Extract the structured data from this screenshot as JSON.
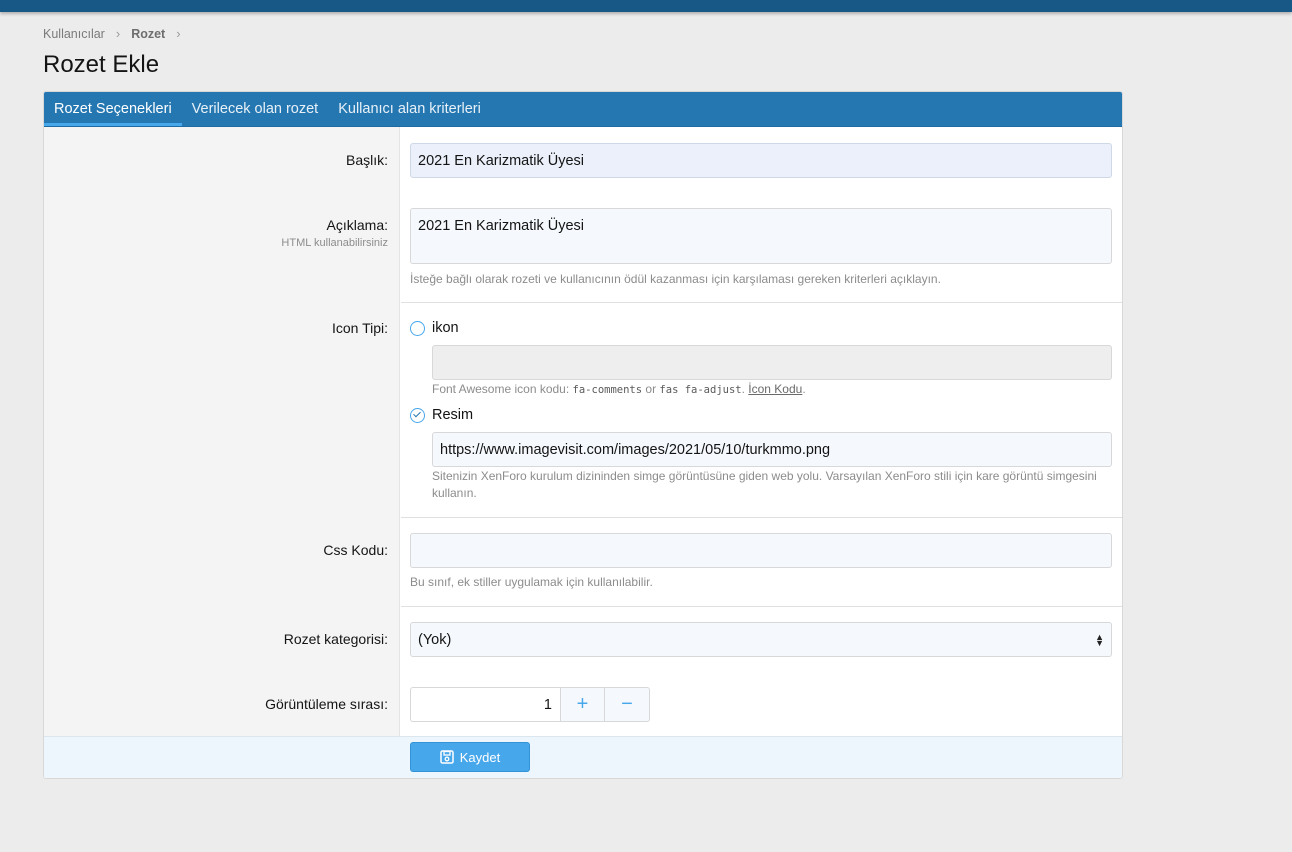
{
  "breadcrumb": {
    "item1": "Kullanıcılar",
    "item2": "Rozet"
  },
  "page_title": "Rozet Ekle",
  "tabs": [
    "Rozet Seçenekleri",
    "Verilecek olan rozet",
    "Kullanıcı alan kriterleri"
  ],
  "form": {
    "title_label": "Başlık:",
    "title_value": "2021 En Karizmatik Üyesi",
    "desc_label": "Açıklama:",
    "desc_hint": "HTML kullanabilirsiniz",
    "desc_value": "2021 En Karizmatik Üyesi",
    "desc_explain": "İsteğe bağlı olarak rozeti ve kullanıcının ödül kazanması için karşılaması gereken kriterleri açıklayın.",
    "icon_type_label": "Icon Tipi:",
    "icon_option": "ikon",
    "icon_explain_prefix": "Font Awesome icon kodu: ",
    "icon_explain_code1": "fa-comments",
    "icon_explain_or": " or ",
    "icon_explain_code2": "fas fa-adjust",
    "icon_explain_dot": ". ",
    "icon_explain_link": "İcon Kodu",
    "icon_explain_end": ".",
    "image_option": "Resim",
    "image_value": "https://www.imagevisit.com/images/2021/05/10/turkmmo.png",
    "image_explain": "Sitenizin XenForo kurulum dizininden simge görüntüsüne giden web yolu. Varsayılan XenForo stili için kare görüntü simgesini kullanın.",
    "css_label": "Css Kodu:",
    "css_value": "",
    "css_explain": "Bu sınıf, ek stiller uygulamak için kullanılabilir.",
    "category_label": "Rozet kategorisi:",
    "category_value": "(Yok)",
    "order_label": "Görüntüleme sırası:",
    "order_value": "1",
    "plus": "+",
    "minus": "−"
  },
  "save_label": "Kaydet",
  "colors": {
    "topbar": "#185886",
    "tabs": "#2577b1",
    "accent": "#47a7eb"
  }
}
